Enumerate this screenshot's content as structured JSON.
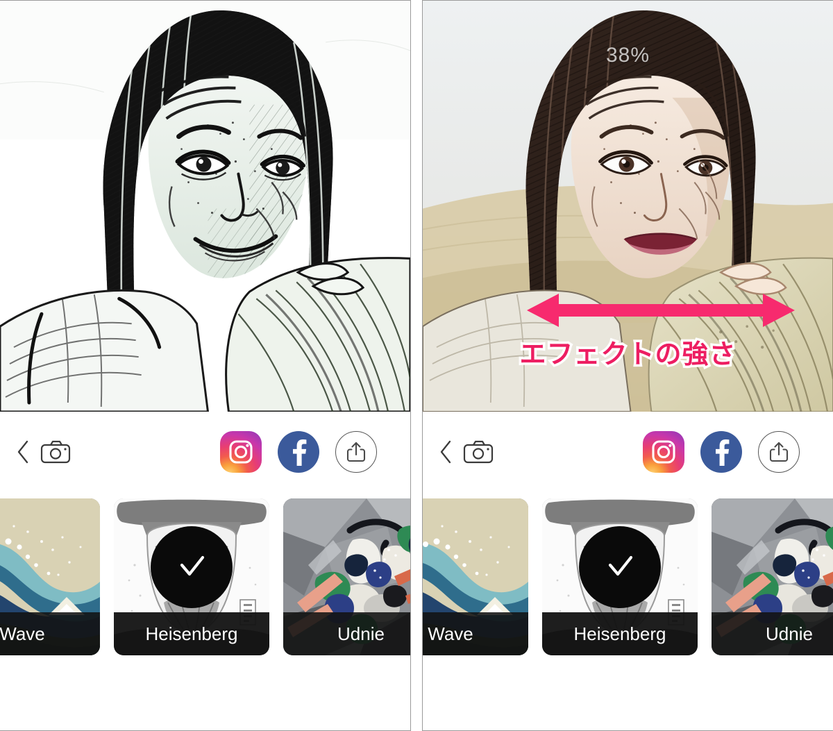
{
  "app": {
    "panels": [
      {
        "id": "panel-full-effect",
        "effect_strength_visible": false,
        "effect_strength": "",
        "annotation_visible": false,
        "annotation_text": ""
      },
      {
        "id": "panel-partial-effect",
        "effect_strength_visible": true,
        "effect_strength": "38%",
        "annotation_visible": true,
        "annotation_text": "エフェクトの強さ"
      }
    ]
  },
  "toolbar": {
    "back_label": "chevron-left",
    "camera_label": "camera",
    "instagram_label": "Instagram",
    "facebook_label": "Facebook",
    "share_label": "Share"
  },
  "styles": {
    "items": [
      {
        "name": "Wave",
        "selected": false,
        "art": "wave"
      },
      {
        "name": "Heisenberg",
        "selected": true,
        "art": "heis"
      },
      {
        "name": "Udnie",
        "selected": false,
        "art": "udnie"
      }
    ]
  },
  "colors": {
    "annotation_pink": "#ED1E62",
    "arrow_pink": "#F72A6E",
    "facebook_blue": "#3B5A9B",
    "panel_border": "#9a9a9a",
    "caption_bg": "#121212"
  }
}
